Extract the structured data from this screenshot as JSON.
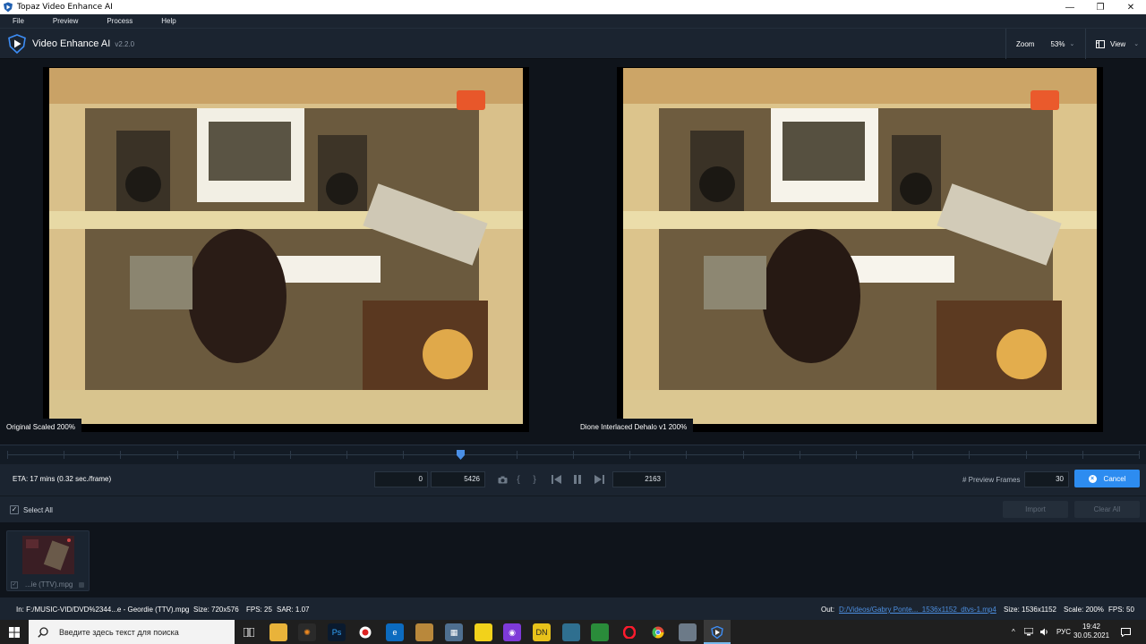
{
  "window": {
    "title": "Topaz Video Enhance AI",
    "controls": [
      "—",
      "❐",
      "✕"
    ]
  },
  "menu": [
    "File",
    "Preview",
    "Process",
    "Help"
  ],
  "header": {
    "app_name": "Video Enhance AI",
    "version": "v2.2.0",
    "zoom_label": "Zoom",
    "zoom_value": "53%",
    "view_label": "View"
  },
  "preview": {
    "left_label": "Original Scaled 200%",
    "right_label": "Dione Interlaced Dehalo v1 200%"
  },
  "timeline": {
    "position": 0.4
  },
  "controls": {
    "eta": "ETA:  17 mins  (0.32 sec./frame)",
    "start_frame": "0",
    "end_frame": "5426",
    "current_frame": "2163",
    "preview_frames_label": "# Preview Frames",
    "preview_frames_value": "30",
    "cancel_label": "Cancel"
  },
  "selection": {
    "select_all_label": "Select All",
    "checkmark": "✓",
    "import_label": "Import",
    "clear_all_label": "Clear All"
  },
  "files": [
    {
      "name": "...ie (TTV).mpg",
      "checked": true
    }
  ],
  "status": {
    "in_path": "In:  F:/MUSIC-VID/DVD%2344...e - Geordie (TTV).mpg",
    "in_size": "Size: 720x576",
    "in_fps": "FPS: 25",
    "in_sar": "SAR: 1.07",
    "out_label": "Out:",
    "out_path": "D:/Videos/Gabry Ponte..._1536x1152_dtvs-1.mp4",
    "out_size": "Size: 1536x1152",
    "out_scale": "Scale: 200%",
    "out_fps": "FPS: 50"
  },
  "taskbar": {
    "search_placeholder": "Введите здесь текст для поиска",
    "lang": "РУС",
    "time": "19:42",
    "date": "30.05.2021",
    "tray_arrow": "^"
  },
  "colors": {
    "accent": "#2d8cf0",
    "panel": "#1b2430",
    "background": "#0f141b"
  }
}
